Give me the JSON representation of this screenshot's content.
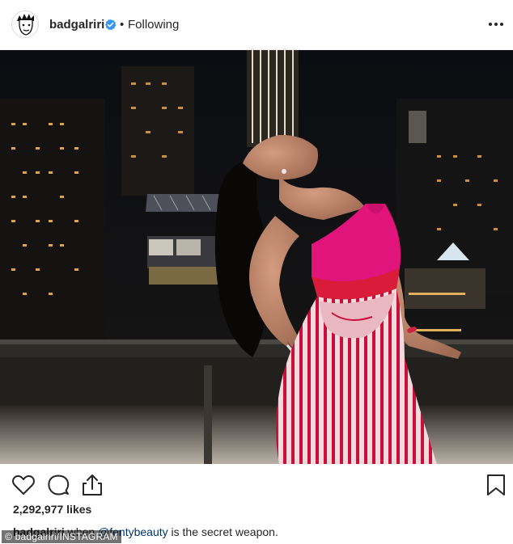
{
  "header": {
    "username": "badgalriri",
    "separator": "•",
    "follow_status": "Following",
    "more_icon": "more-horizontal-icon",
    "verified_icon": "verified-badge-icon",
    "avatar_icon": "avatar-cartoon-icon"
  },
  "post": {
    "photo_description_icon": "photo",
    "likes": "2,292,977 likes",
    "caption": {
      "username": "badgalriri",
      "before_mention": " when ",
      "mention": "@fentybeauty",
      "after_mention": " is the secret weapon."
    }
  },
  "actions": {
    "like_icon": "heart-icon",
    "comment_icon": "comment-icon",
    "share_icon": "share-icon",
    "save_icon": "bookmark-icon"
  },
  "watermark": "© badgalriri/INSTAGRAM",
  "colors": {
    "verified_blue": "#3897f0",
    "mention_blue": "#003569",
    "text": "#262626",
    "top_pink": "#e0147a",
    "skirt_red": "#c8102e"
  }
}
